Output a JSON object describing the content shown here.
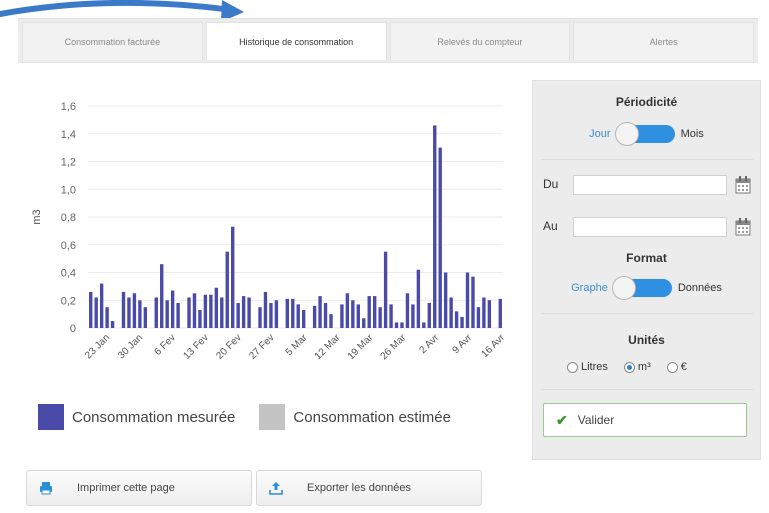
{
  "tabs": [
    {
      "label": "Consommation facturée"
    },
    {
      "label": "Historique de consommation"
    },
    {
      "label": "Relevés du compteur"
    },
    {
      "label": "Alertes"
    }
  ],
  "colors": {
    "measured": "#4a4aa8",
    "estimated": "#c4c4c4",
    "accent": "#2f8fe0",
    "arrow": "#3a7ac8"
  },
  "chart_data": {
    "type": "bar",
    "ylabel": "m3",
    "ylim": [
      0,
      1.6
    ],
    "yticks": [
      "0",
      "0,2",
      "0,4",
      "0,6",
      "0,8",
      "1,0",
      "1,2",
      "1,4",
      "1,6"
    ],
    "xticks": [
      "23 Jan",
      "30 Jan",
      "6 Fev",
      "13 Fev",
      "20 Fev",
      "27 Fev",
      "5 Mar",
      "12 Mar",
      "19 Mar",
      "26 Mar",
      "2 Avr",
      "9 Avr",
      "16 Avr"
    ],
    "grid": true,
    "series": [
      {
        "name": "Consommation mesurée",
        "values": [
          0.26,
          0.22,
          0.32,
          0.15,
          0.05,
          null,
          0.26,
          0.22,
          0.25,
          0.2,
          0.15,
          null,
          0.22,
          0.46,
          0.2,
          0.27,
          0.18,
          null,
          0.22,
          0.25,
          0.13,
          0.24,
          0.24,
          0.29,
          0.22,
          0.55,
          0.73,
          0.18,
          0.23,
          0.22,
          null,
          0.15,
          0.26,
          0.18,
          0.2,
          null,
          0.21,
          0.21,
          0.17,
          0.13,
          null,
          0.16,
          0.23,
          0.18,
          0.1,
          null,
          0.17,
          0.25,
          0.2,
          0.17,
          0.07,
          0.23,
          0.23,
          0.15,
          0.55,
          0.17,
          0.04,
          0.04,
          0.25,
          0.17,
          0.42,
          0.04,
          0.18,
          1.46,
          1.3,
          0.4,
          0.22,
          0.12,
          0.08,
          0.4,
          0.37,
          0.15,
          0.22,
          0.2,
          null,
          0.21
        ]
      }
    ],
    "legend": [
      {
        "label": "Consommation mesurée"
      },
      {
        "label": "Consommation estimée"
      }
    ]
  },
  "panel": {
    "periodicity": {
      "title": "Périodicité",
      "left": "Jour",
      "right": "Mois"
    },
    "from_label": "Du",
    "to_label": "Au",
    "from_value": "",
    "to_value": "",
    "format": {
      "title": "Format",
      "left": "Graphe",
      "right": "Données"
    },
    "units": {
      "title": "Unités",
      "options": [
        "Litres",
        "m³",
        "€"
      ],
      "selected": "m³"
    },
    "validate_label": "Valider"
  },
  "actions": {
    "print_label": "Imprimer cette page",
    "export_label": "Exporter les données"
  }
}
